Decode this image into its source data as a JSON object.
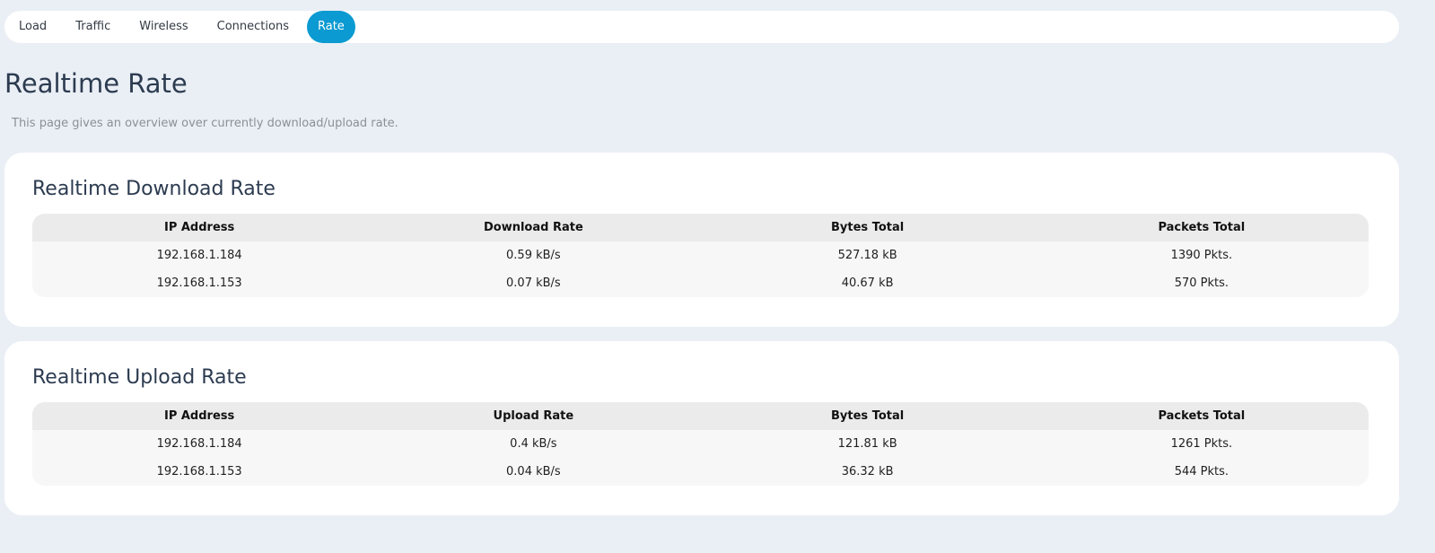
{
  "tabs": [
    {
      "label": "Load"
    },
    {
      "label": "Traffic"
    },
    {
      "label": "Wireless"
    },
    {
      "label": "Connections"
    },
    {
      "label": "Rate",
      "active": true
    }
  ],
  "page": {
    "title": "Realtime Rate",
    "description": "This page gives an overview over currently download/upload rate."
  },
  "download": {
    "title": "Realtime Download Rate",
    "headers": [
      "IP Address",
      "Download Rate",
      "Bytes Total",
      "Packets Total"
    ],
    "rows": [
      [
        "192.168.1.184",
        "0.59 kB/s",
        "527.18 kB",
        "1390 Pkts."
      ],
      [
        "192.168.1.153",
        "0.07 kB/s",
        "40.67 kB",
        "570 Pkts."
      ]
    ]
  },
  "upload": {
    "title": "Realtime Upload Rate",
    "headers": [
      "IP Address",
      "Upload Rate",
      "Bytes Total",
      "Packets Total"
    ],
    "rows": [
      [
        "192.168.1.184",
        "0.4 kB/s",
        "121.81 kB",
        "1261 Pkts."
      ],
      [
        "192.168.1.153",
        "0.04 kB/s",
        "36.32 kB",
        "544 Pkts."
      ]
    ]
  },
  "colors": {
    "accent": "#0b9ad1",
    "background": "#eaeff5",
    "title": "#2c3b50"
  }
}
